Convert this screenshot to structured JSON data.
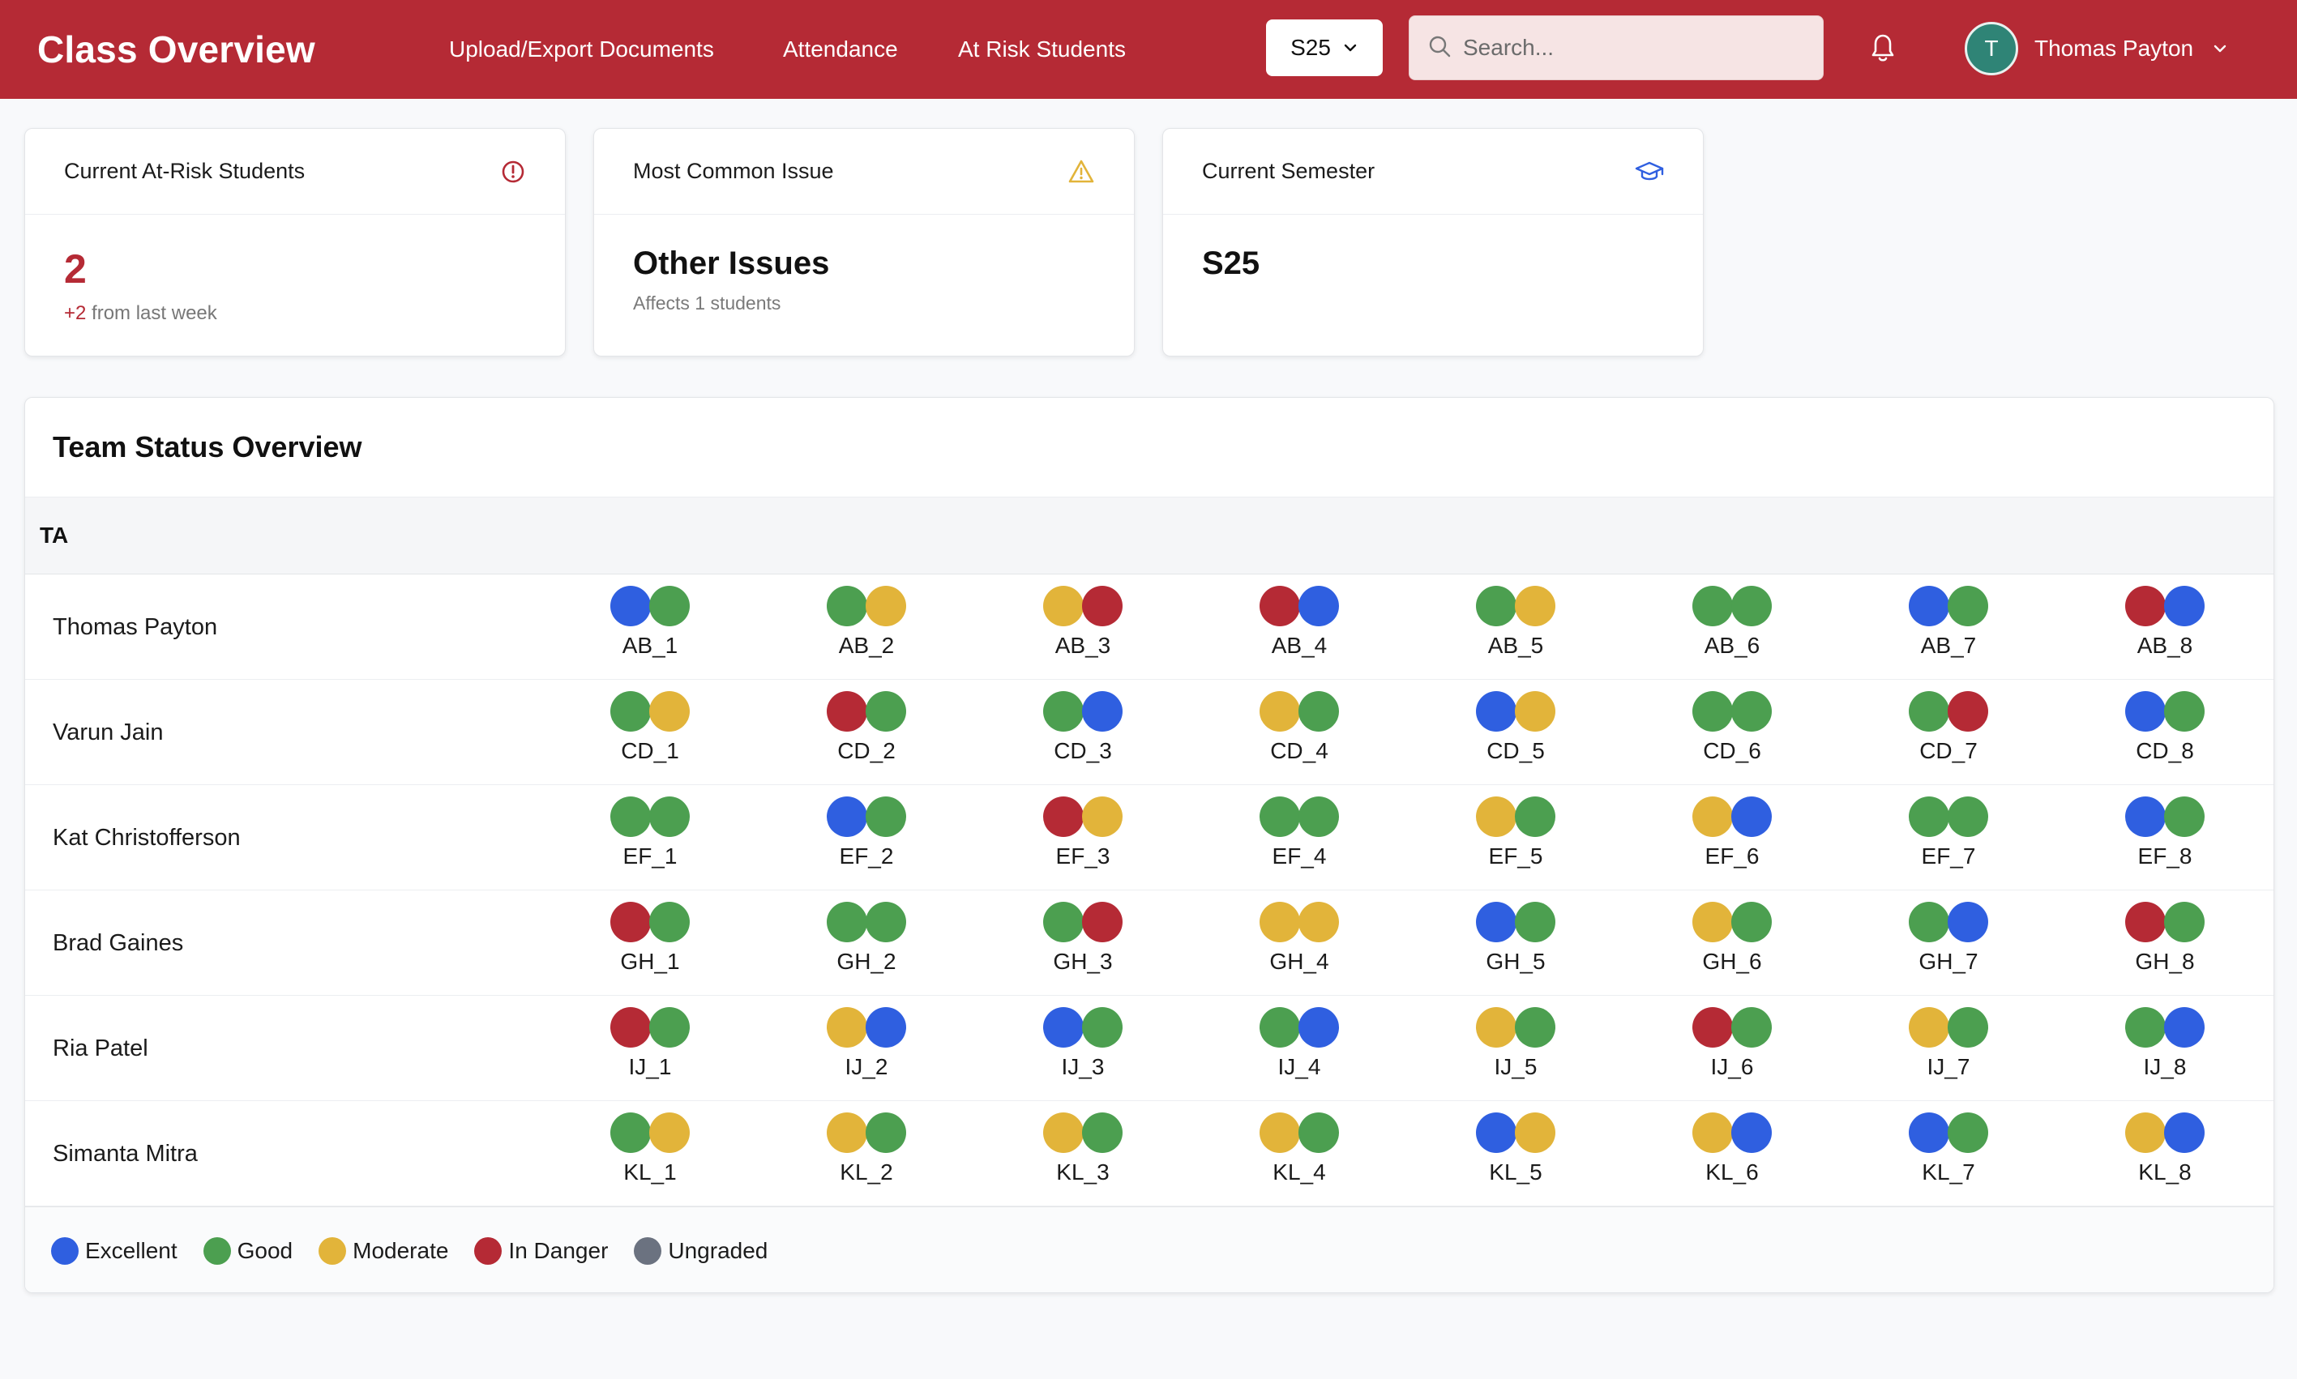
{
  "header": {
    "title": "Class Overview",
    "nav": [
      "Upload/Export Documents",
      "Attendance",
      "At Risk Students"
    ],
    "semester_select": "S25",
    "search_placeholder": "Search...",
    "user": {
      "initial": "T",
      "name": "Thomas Payton"
    }
  },
  "cards": {
    "at_risk": {
      "title": "Current At-Risk Students",
      "value": "2",
      "delta": "+2",
      "delta_text": "from last week",
      "icon": "alert-circle-icon"
    },
    "common_issue": {
      "title": "Most Common Issue",
      "value": "Other Issues",
      "note": "Affects 1 students",
      "icon": "warning-triangle-icon"
    },
    "semester": {
      "title": "Current Semester",
      "value": "S25",
      "icon": "graduation-cap-icon"
    }
  },
  "team_status": {
    "title": "Team Status Overview",
    "column_header": "TA",
    "colors": {
      "excellent": "#2f5fe0",
      "good": "#4c9f50",
      "moderate": "#e2b43a",
      "danger": "#b52a35",
      "ungraded": "#6b7280"
    },
    "rows": [
      {
        "ta": "Thomas Payton",
        "teams": [
          {
            "name": "AB_1",
            "status": [
              "excellent",
              "good"
            ]
          },
          {
            "name": "AB_2",
            "status": [
              "good",
              "moderate"
            ]
          },
          {
            "name": "AB_3",
            "status": [
              "moderate",
              "danger"
            ]
          },
          {
            "name": "AB_4",
            "status": [
              "danger",
              "excellent"
            ]
          },
          {
            "name": "AB_5",
            "status": [
              "good",
              "moderate"
            ]
          },
          {
            "name": "AB_6",
            "status": [
              "good",
              "good"
            ]
          },
          {
            "name": "AB_7",
            "status": [
              "excellent",
              "good"
            ]
          },
          {
            "name": "AB_8",
            "status": [
              "danger",
              "excellent"
            ]
          }
        ]
      },
      {
        "ta": "Varun Jain",
        "teams": [
          {
            "name": "CD_1",
            "status": [
              "good",
              "moderate"
            ]
          },
          {
            "name": "CD_2",
            "status": [
              "danger",
              "good"
            ]
          },
          {
            "name": "CD_3",
            "status": [
              "good",
              "excellent"
            ]
          },
          {
            "name": "CD_4",
            "status": [
              "moderate",
              "good"
            ]
          },
          {
            "name": "CD_5",
            "status": [
              "excellent",
              "moderate"
            ]
          },
          {
            "name": "CD_6",
            "status": [
              "good",
              "good"
            ]
          },
          {
            "name": "CD_7",
            "status": [
              "good",
              "danger"
            ]
          },
          {
            "name": "CD_8",
            "status": [
              "excellent",
              "good"
            ]
          }
        ]
      },
      {
        "ta": "Kat Christofferson",
        "teams": [
          {
            "name": "EF_1",
            "status": [
              "good",
              "good"
            ]
          },
          {
            "name": "EF_2",
            "status": [
              "excellent",
              "good"
            ]
          },
          {
            "name": "EF_3",
            "status": [
              "danger",
              "moderate"
            ]
          },
          {
            "name": "EF_4",
            "status": [
              "good",
              "good"
            ]
          },
          {
            "name": "EF_5",
            "status": [
              "moderate",
              "good"
            ]
          },
          {
            "name": "EF_6",
            "status": [
              "moderate",
              "excellent"
            ]
          },
          {
            "name": "EF_7",
            "status": [
              "good",
              "good"
            ]
          },
          {
            "name": "EF_8",
            "status": [
              "excellent",
              "good"
            ]
          }
        ]
      },
      {
        "ta": "Brad Gaines",
        "teams": [
          {
            "name": "GH_1",
            "status": [
              "danger",
              "good"
            ]
          },
          {
            "name": "GH_2",
            "status": [
              "good",
              "good"
            ]
          },
          {
            "name": "GH_3",
            "status": [
              "good",
              "danger"
            ]
          },
          {
            "name": "GH_4",
            "status": [
              "moderate",
              "moderate"
            ]
          },
          {
            "name": "GH_5",
            "status": [
              "excellent",
              "good"
            ]
          },
          {
            "name": "GH_6",
            "status": [
              "moderate",
              "good"
            ]
          },
          {
            "name": "GH_7",
            "status": [
              "good",
              "excellent"
            ]
          },
          {
            "name": "GH_8",
            "status": [
              "danger",
              "good"
            ]
          }
        ]
      },
      {
        "ta": "Ria Patel",
        "teams": [
          {
            "name": "IJ_1",
            "status": [
              "danger",
              "good"
            ]
          },
          {
            "name": "IJ_2",
            "status": [
              "moderate",
              "excellent"
            ]
          },
          {
            "name": "IJ_3",
            "status": [
              "excellent",
              "good"
            ]
          },
          {
            "name": "IJ_4",
            "status": [
              "good",
              "excellent"
            ]
          },
          {
            "name": "IJ_5",
            "status": [
              "moderate",
              "good"
            ]
          },
          {
            "name": "IJ_6",
            "status": [
              "danger",
              "good"
            ]
          },
          {
            "name": "IJ_7",
            "status": [
              "moderate",
              "good"
            ]
          },
          {
            "name": "IJ_8",
            "status": [
              "good",
              "excellent"
            ]
          }
        ]
      },
      {
        "ta": "Simanta Mitra",
        "teams": [
          {
            "name": "KL_1",
            "status": [
              "good",
              "moderate"
            ]
          },
          {
            "name": "KL_2",
            "status": [
              "moderate",
              "good"
            ]
          },
          {
            "name": "KL_3",
            "status": [
              "moderate",
              "good"
            ]
          },
          {
            "name": "KL_4",
            "status": [
              "moderate",
              "good"
            ]
          },
          {
            "name": "KL_5",
            "status": [
              "excellent",
              "moderate"
            ]
          },
          {
            "name": "KL_6",
            "status": [
              "moderate",
              "excellent"
            ]
          },
          {
            "name": "KL_7",
            "status": [
              "excellent",
              "good"
            ]
          },
          {
            "name": "KL_8",
            "status": [
              "moderate",
              "excellent"
            ]
          }
        ]
      }
    ],
    "legend": [
      {
        "key": "excellent",
        "label": "Excellent"
      },
      {
        "key": "good",
        "label": "Good"
      },
      {
        "key": "moderate",
        "label": "Moderate"
      },
      {
        "key": "danger",
        "label": "In Danger"
      },
      {
        "key": "ungraded",
        "label": "Ungraded"
      }
    ]
  }
}
